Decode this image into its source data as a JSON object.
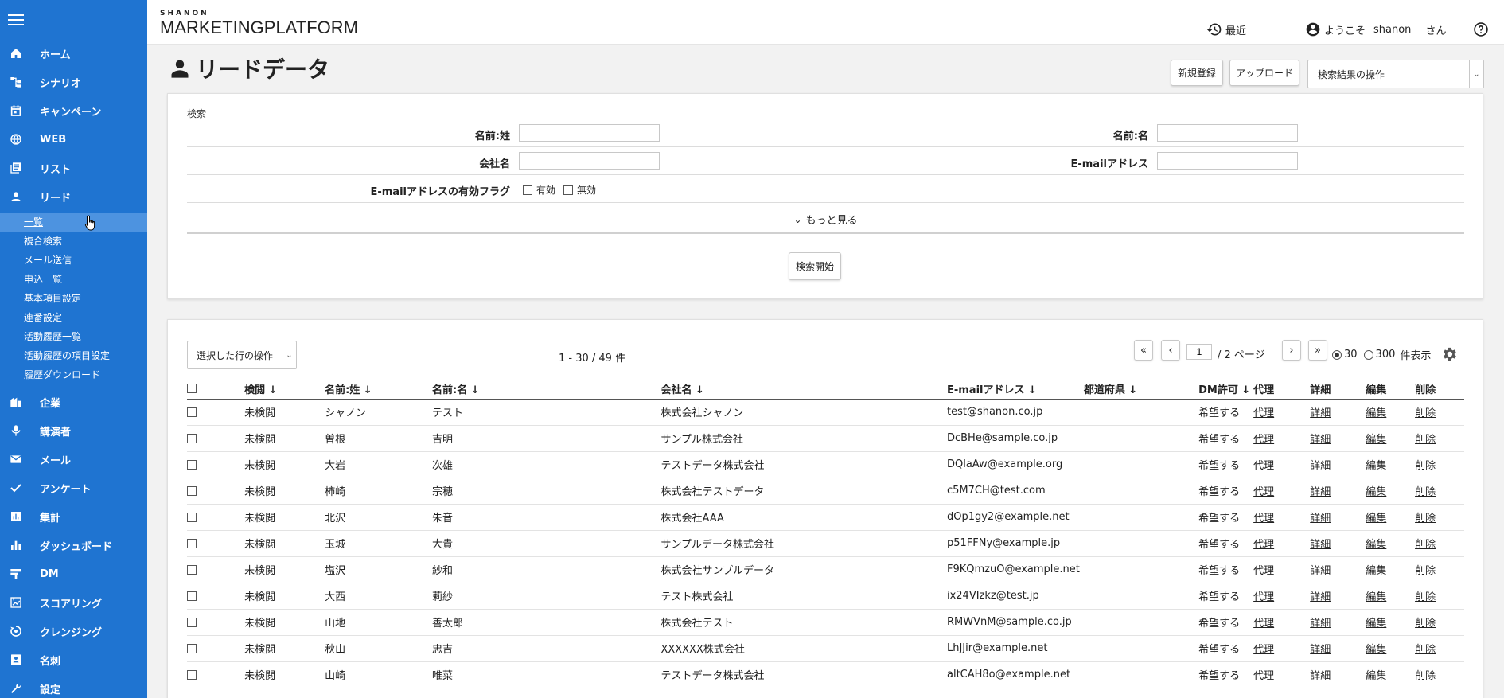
{
  "app": {
    "brand_small": "SHANON",
    "brand_main": "MARKETINGPLATFORM"
  },
  "topbar": {
    "recent": "最近",
    "welcome": "ようこそ",
    "username": "shanon",
    "honorific": "さん"
  },
  "sidebar": {
    "items": [
      {
        "label": "ホーム",
        "icon": "home-icon"
      },
      {
        "label": "シナリオ",
        "icon": "scenario-icon"
      },
      {
        "label": "キャンペーン",
        "icon": "calendar-icon"
      },
      {
        "label": "WEB",
        "icon": "globe-icon"
      },
      {
        "label": "リスト",
        "icon": "list-icon"
      },
      {
        "label": "リード",
        "icon": "person-icon"
      }
    ],
    "sub_items": [
      {
        "label": "一覧",
        "active": true
      },
      {
        "label": "複合検索"
      },
      {
        "label": "メール送信"
      },
      {
        "label": "申込一覧"
      },
      {
        "label": "基本項目設定"
      },
      {
        "label": "連番設定"
      },
      {
        "label": "活動履歴一覧"
      },
      {
        "label": "活動履歴の項目設定"
      },
      {
        "label": "履歴ダウンロード"
      }
    ],
    "items_after": [
      {
        "label": "企業",
        "icon": "building-icon"
      },
      {
        "label": "講演者",
        "icon": "mic-icon"
      },
      {
        "label": "メール",
        "icon": "mail-icon"
      },
      {
        "label": "アンケート",
        "icon": "check-icon"
      },
      {
        "label": "集計",
        "icon": "report-icon"
      },
      {
        "label": "ダッシュボード",
        "icon": "bar-chart-icon"
      },
      {
        "label": "DM",
        "icon": "dm-icon"
      },
      {
        "label": "スコアリング",
        "icon": "scoring-icon"
      },
      {
        "label": "クレンジング",
        "icon": "cleansing-icon"
      },
      {
        "label": "名刺",
        "icon": "card-icon"
      },
      {
        "label": "設定",
        "icon": "wrench-icon"
      }
    ]
  },
  "page": {
    "title": "リードデータ",
    "new_button": "新規登録",
    "upload_button": "アップロード",
    "search_ops": "検索結果の操作"
  },
  "search": {
    "section_label": "検索",
    "last_name_label": "名前:姓",
    "last_name_value": "",
    "first_name_label": "名前:名",
    "first_name_value": "",
    "company_label": "会社名",
    "company_value": "",
    "email_label": "E-mailアドレス",
    "email_value": "",
    "email_flag_label": "E-mailアドレスの有効フラグ",
    "valid_label": "有効",
    "invalid_label": "無効",
    "more_label": "もっと見る",
    "submit_label": "検索開始"
  },
  "results": {
    "row_ops": "選択した行の操作",
    "count_text": "1 - 30 / 49 件",
    "current_page": "1",
    "total_pages_text": "/ 2 ページ",
    "size_30": "30",
    "size_300": "300",
    "size_suffix": "件表示",
    "size_selected": "30",
    "columns": [
      "検閲 ↓",
      "名前:姓 ↓",
      "名前:名 ↓",
      "会社名 ↓",
      "E-mailアドレス ↓",
      "都道府県 ↓",
      "DM許可 ↓",
      "代理",
      "詳細",
      "編集",
      "削除"
    ],
    "link_labels": {
      "proxy": "代理",
      "detail": "詳細",
      "edit": "編集",
      "delete": "削除"
    },
    "rows": [
      {
        "status": "未検閲",
        "last": "シャノン",
        "first": "テスト",
        "company": "株式会社シャノン",
        "email": "test@shanon.co.jp",
        "pref": "",
        "dm": "希望する"
      },
      {
        "status": "未検閲",
        "last": "曽根",
        "first": "吉明",
        "company": "サンプル株式会社",
        "email": "DcBHe@sample.co.jp",
        "pref": "",
        "dm": "希望する"
      },
      {
        "status": "未検閲",
        "last": "大岩",
        "first": "次雄",
        "company": "テストデータ株式会社",
        "email": "DQlaAw@example.org",
        "pref": "",
        "dm": "希望する"
      },
      {
        "status": "未検閲",
        "last": "柿崎",
        "first": "宗穂",
        "company": "株式会社テストデータ",
        "email": "c5M7CH@test.com",
        "pref": "",
        "dm": "希望する"
      },
      {
        "status": "未検閲",
        "last": "北沢",
        "first": "朱音",
        "company": "株式会社AAA",
        "email": "dOp1gy2@example.net",
        "pref": "",
        "dm": "希望する"
      },
      {
        "status": "未検閲",
        "last": "玉城",
        "first": "大貴",
        "company": "サンプルデータ株式会社",
        "email": "p51FFNy@example.jp",
        "pref": "",
        "dm": "希望する"
      },
      {
        "status": "未検閲",
        "last": "塩沢",
        "first": "紗和",
        "company": "株式会社サンプルデータ",
        "email": "F9KQmzuO@example.net",
        "pref": "",
        "dm": "希望する"
      },
      {
        "status": "未検閲",
        "last": "大西",
        "first": "莉紗",
        "company": "テスト株式会社",
        "email": "ix24VIzkz@test.jp",
        "pref": "",
        "dm": "希望する"
      },
      {
        "status": "未検閲",
        "last": "山地",
        "first": "善太郎",
        "company": "株式会社テスト",
        "email": "RMWVnM@sample.co.jp",
        "pref": "",
        "dm": "希望する"
      },
      {
        "status": "未検閲",
        "last": "秋山",
        "first": "忠吉",
        "company": "XXXXXX株式会社",
        "email": "LhJJir@example.net",
        "pref": "",
        "dm": "希望する"
      },
      {
        "status": "未検閲",
        "last": "山崎",
        "first": "唯菜",
        "company": "テストデータ株式会社",
        "email": "altCAH8o@example.net",
        "pref": "",
        "dm": "希望する"
      }
    ]
  },
  "colors": {
    "sidebar_bg": "#1f74d1",
    "sidebar_active": "#4d93e0",
    "page_bg": "#f2f2f2"
  }
}
